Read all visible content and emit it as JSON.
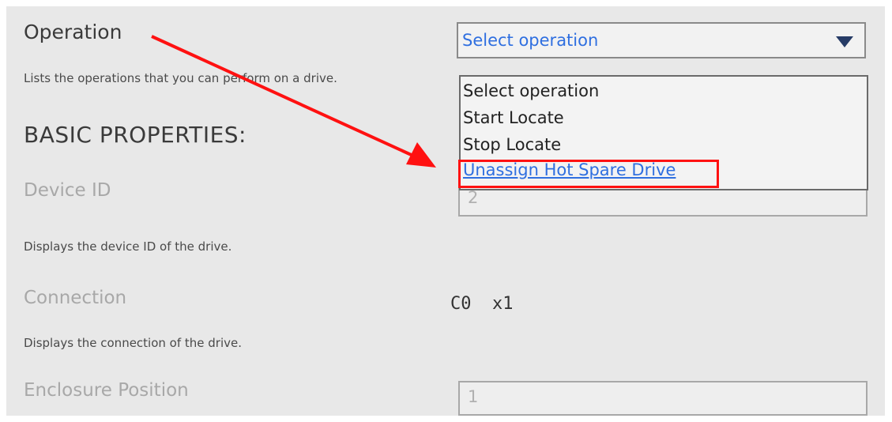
{
  "operation": {
    "label": "Operation",
    "description": "Lists the operations that you can perform on a drive.",
    "selected": "Select operation",
    "options": [
      "Select operation",
      "Start Locate",
      "Stop Locate",
      "Unassign Hot Spare Drive"
    ]
  },
  "basic_properties": {
    "heading": "BASIC PROPERTIES:",
    "device_id": {
      "label": "Device ID",
      "value": "2",
      "description": "Displays the device ID of the drive."
    },
    "connection": {
      "label": "Connection",
      "value": "C0  x1",
      "description": "Displays the connection of the drive."
    },
    "enclosure_position": {
      "label": "Enclosure Position",
      "value": "1"
    }
  },
  "colors": {
    "accent_text": "#2f6fe0",
    "annotation": "#ff1111",
    "dropdown_arrow": "#263b66"
  },
  "icons": {
    "dropdown": "triangle-down-icon",
    "annotation_arrow": "red-arrow-icon"
  }
}
